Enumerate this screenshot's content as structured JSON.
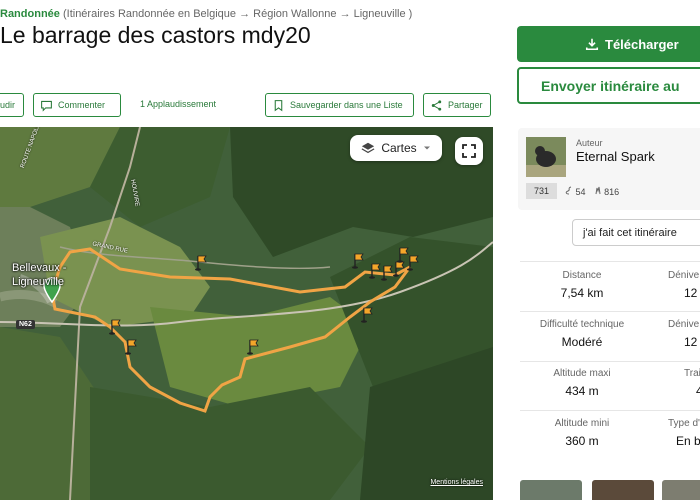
{
  "breadcrumb": {
    "type": "Randonnée",
    "path": "(Itinéraires Randonnée en Belgique → Région Wallonne → Ligneuville )"
  },
  "title": "Le barrage des castors mdy20",
  "actions": {
    "audio_label": "audir",
    "comment_label": "Commenter",
    "applause_label": "1 Applaudissement",
    "save_label": "Sauvegarder dans une Liste",
    "share_label": "Partager"
  },
  "map": {
    "layers_label": "Cartes",
    "town_label_1": "Bellevaux -",
    "town_label_2": "Ligneuville",
    "road_napoleon": "ROUTE NAPOLÉON",
    "road_grand_rue": "GRAND RUE",
    "road_houvire": "HOUVIRE",
    "road_shield": "N62",
    "legal_label": "Mentions légales",
    "route_color": "#f0a445"
  },
  "sidebar": {
    "download_label": "Télécharger",
    "send_label": "Envoyer itinéraire au",
    "author_role": "Auteur",
    "author_name": "Eternal Spark",
    "author_points": "731",
    "author_stat_2": "54",
    "author_stat_3": "816",
    "done_label": "j'ai fait cet itinéraire",
    "accent_color": "#2a8a3e"
  },
  "stats": {
    "distance_label": "Distance",
    "distance_value": "7,54 km",
    "elev_gain_label": "Dénive",
    "elev_gain_value": "12",
    "difficulty_label": "Difficulté technique",
    "difficulty_value": "Modéré",
    "elev_loss_label": "Dénive",
    "elev_loss_value": "12",
    "alt_max_label": "Altitude maxi",
    "alt_max_value": "434 m",
    "trail_label": "Trai",
    "trail_value": "4",
    "alt_min_label": "Altitude mini",
    "alt_min_value": "360 m",
    "type_label": "Type d'",
    "type_value": "En b"
  }
}
